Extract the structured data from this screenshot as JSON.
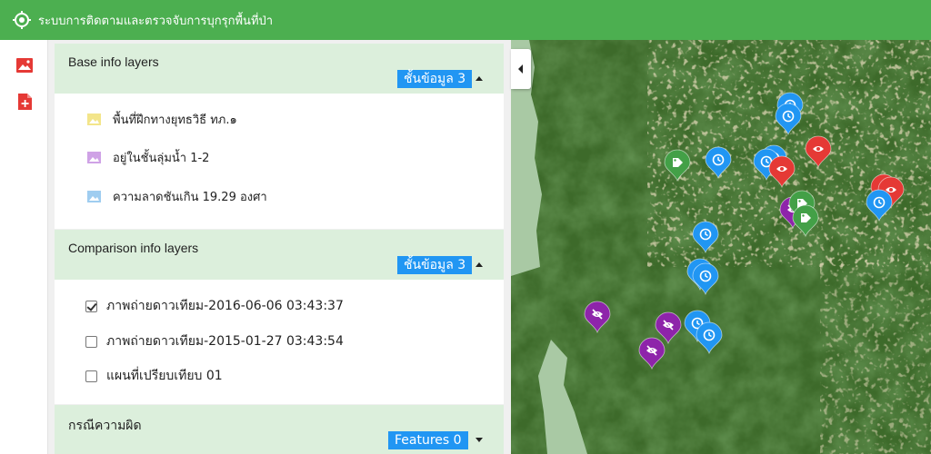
{
  "app": {
    "title": "ระบบการติดตามและตรวจจับการบุกรุกพื้นที่ป่า"
  },
  "colors": {
    "topbar": "#4caf50",
    "accent_blue": "#2196f3",
    "section_header": "#dcefdc",
    "rail_icon": "#e53935"
  },
  "rail": {
    "icons": [
      "image-icon",
      "add-file-icon"
    ]
  },
  "base_layers": {
    "title": "Base info layers",
    "badge": "ชั้นข้อมูล 3",
    "expanded": true,
    "items": [
      {
        "label": "พื้นที่ฝึกทางยุทธวิธี ทภ.๑",
        "icon_color": "#f3e58a"
      },
      {
        "label": "อยู่ในชั้นลุ่มน้ำ 1-2",
        "icon_color": "#cfa2e6"
      },
      {
        "label": "ความลาดชันเกิน 19.29 องศา",
        "icon_color": "#9fcdf0"
      }
    ]
  },
  "comparison_layers": {
    "title": "Comparison info layers",
    "badge": "ชั้นข้อมูล 3",
    "expanded": true,
    "items": [
      {
        "label": "ภาพถ่ายดาวเทียม-2016-06-06 03:43:37",
        "checked": true
      },
      {
        "label": "ภาพถ่ายดาวเทียม-2015-01-27 03:43:54",
        "checked": false
      },
      {
        "label": "แผนที่เปรียบเทียบ 01",
        "checked": false
      }
    ]
  },
  "incidents": {
    "title": "กรณีความผิด",
    "badge": "Features 0",
    "expanded": false
  },
  "map": {
    "markers": [
      {
        "type": "clock",
        "color": "#2196f3"
      },
      {
        "type": "clock",
        "color": "#2196f3"
      },
      {
        "type": "tag",
        "color": "#43a047"
      },
      {
        "type": "clock",
        "color": "#2196f3"
      },
      {
        "type": "clock",
        "color": "#2196f3"
      },
      {
        "type": "clock",
        "color": "#2196f3"
      },
      {
        "type": "eye",
        "color": "#e53935"
      },
      {
        "type": "eye",
        "color": "#e53935"
      },
      {
        "type": "eye",
        "color": "#e53935"
      },
      {
        "type": "eye-off",
        "color": "#8e24aa"
      },
      {
        "type": "tag",
        "color": "#43a047"
      },
      {
        "type": "eye",
        "color": "#e53935"
      },
      {
        "type": "tag",
        "color": "#43a047"
      },
      {
        "type": "clock",
        "color": "#2196f3"
      },
      {
        "type": "clock",
        "color": "#2196f3"
      },
      {
        "type": "clock",
        "color": "#2196f3"
      },
      {
        "type": "clock",
        "color": "#2196f3"
      },
      {
        "type": "eye-off",
        "color": "#8e24aa"
      },
      {
        "type": "clock",
        "color": "#2196f3"
      },
      {
        "type": "eye-off",
        "color": "#8e24aa"
      },
      {
        "type": "clock",
        "color": "#2196f3"
      },
      {
        "type": "eye-off",
        "color": "#8e24aa"
      }
    ]
  }
}
